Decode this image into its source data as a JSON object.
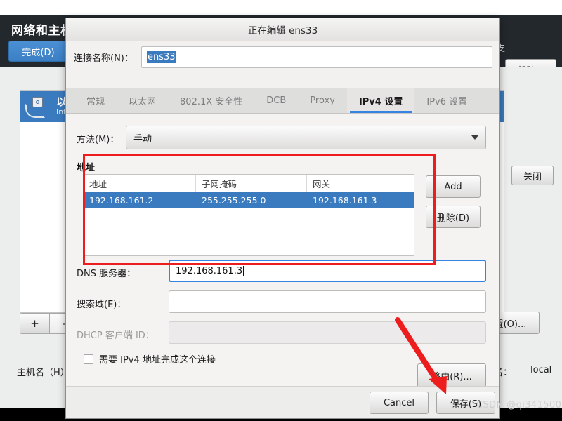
{
  "background_window": {
    "title": "网络和主机名",
    "done_button": "完成(D)",
    "help_button": "帮助！",
    "header_right_partial": "支",
    "close_button": "关闭",
    "connection_item": {
      "name": "以太网",
      "detail": "Intel"
    },
    "add_button": "+",
    "remove_button": "–",
    "configure_button": "配置(O)...",
    "hostname_label": "主机名（H）",
    "hostname_value_label": "机名：",
    "hostname_value": "local"
  },
  "dialog": {
    "title": "正在编辑 ens33",
    "connection_name_label": "连接名称(N)：",
    "connection_name_value": "ens33",
    "tabs": [
      {
        "label": "常规",
        "active": false
      },
      {
        "label": "以太网",
        "active": false
      },
      {
        "label": "802.1X 安全性",
        "active": false
      },
      {
        "label": "DCB",
        "active": false
      },
      {
        "label": "Proxy",
        "active": false
      },
      {
        "label": "IPv4 设置",
        "active": true
      },
      {
        "label": "IPv6 设置",
        "active": false
      }
    ],
    "method": {
      "label": "方法(M)：",
      "value": "手动"
    },
    "addresses": {
      "heading": "地址",
      "columns": [
        "地址",
        "子网掩码",
        "网关"
      ],
      "rows": [
        [
          "192.168.161.2",
          "255.255.255.0",
          "192.168.161.3"
        ]
      ],
      "add_button": "Add",
      "delete_button": "删除(D)"
    },
    "dns": {
      "label": "DNS 服务器：",
      "value": "192.168.161.3"
    },
    "search_domains": {
      "label": "搜索域(E)：",
      "value": ""
    },
    "dhcp_client_id": {
      "label": "DHCP 客户端 ID：",
      "value": ""
    },
    "require_ipv4_checkbox": {
      "label": "需要 IPv4 地址完成这个连接",
      "checked": false
    },
    "routes_button": "路由(R)...",
    "footer": {
      "cancel_button": "Cancel",
      "save_button": "保存(S)"
    }
  },
  "annotations": {
    "highlight_color": "#ee1d1d",
    "arrow_color": "#ee1d1d",
    "watermark": "CSDN @qi341500"
  },
  "colors": {
    "accent_blue": "#3584e4",
    "selection_blue": "#3a7bbf",
    "header_dark": "#23282d",
    "dialog_bg": "#f2f1f0"
  }
}
